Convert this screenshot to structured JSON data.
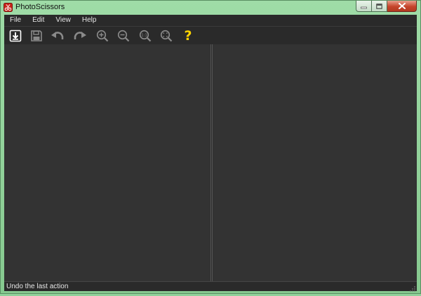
{
  "window": {
    "title": "PhotoScissors",
    "icon": "photoscissors-app-icon",
    "caption_buttons": [
      "minimize-icon",
      "maximize-icon",
      "close-icon"
    ]
  },
  "menu": {
    "items": [
      {
        "label": "File"
      },
      {
        "label": "Edit"
      },
      {
        "label": "View"
      },
      {
        "label": "Help"
      }
    ]
  },
  "toolbar": {
    "buttons": [
      {
        "name": "open",
        "icon": "open-image-icon"
      },
      {
        "name": "save",
        "icon": "save-icon"
      },
      {
        "name": "undo",
        "icon": "undo-icon"
      },
      {
        "name": "redo",
        "icon": "redo-icon"
      },
      {
        "name": "zoom-in",
        "icon": "zoom-in-icon"
      },
      {
        "name": "zoom-out",
        "icon": "zoom-out-icon"
      },
      {
        "name": "actual-size",
        "icon": "zoom-actual-size-icon",
        "text": "1:1"
      },
      {
        "name": "fit",
        "icon": "zoom-fit-icon"
      },
      {
        "name": "help",
        "icon": "help-icon",
        "text": "?"
      }
    ],
    "colors": {
      "icon_active": "#ffffff",
      "icon_dim": "#8a8a8a",
      "help": "#ffd400"
    }
  },
  "status": {
    "text": "Undo the last action"
  }
}
